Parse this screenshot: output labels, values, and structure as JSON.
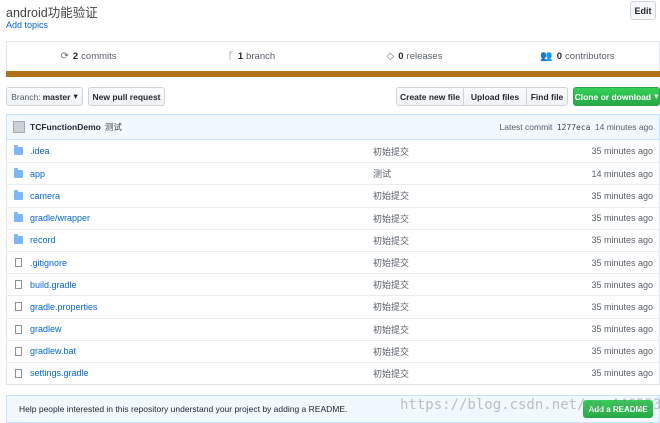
{
  "repo": {
    "title": "android功能验证",
    "add_topics": "Add topics",
    "edit_label": "Edit"
  },
  "summary": {
    "commits_count": "2",
    "commits_label": "commits",
    "branches_count": "1",
    "branches_label": "branch",
    "releases_count": "0",
    "releases_label": "releases",
    "contributors_count": "0",
    "contributors_label": "contributors"
  },
  "colors": {
    "language_bar": "#b07219",
    "primary_green": "#28a745",
    "link": "#0366d6"
  },
  "toolbar": {
    "branch_label": "Branch:",
    "branch_value": "master",
    "new_pull_request": "New pull request",
    "create_new_file": "Create new file",
    "upload_files": "Upload files",
    "find_file": "Find file",
    "clone_or_download": "Clone or download"
  },
  "latest_commit": {
    "author": "TCFunctionDemo",
    "message": "测试",
    "prefix": "Latest commit",
    "sha": "1277eca",
    "time": "14 minutes ago"
  },
  "files": [
    {
      "name": ".idea",
      "type": "dir",
      "message": "初始提交",
      "age": "35 minutes ago"
    },
    {
      "name": "app",
      "type": "dir",
      "message": "测试",
      "age": "14 minutes ago"
    },
    {
      "name": "camera",
      "type": "dir",
      "message": "初始提交",
      "age": "35 minutes ago"
    },
    {
      "name": "gradle/wrapper",
      "type": "dir",
      "message": "初始提交",
      "age": "35 minutes ago"
    },
    {
      "name": "record",
      "type": "dir",
      "message": "初始提交",
      "age": "35 minutes ago"
    },
    {
      "name": ".gitignore",
      "type": "file",
      "message": "初始提交",
      "age": "35 minutes ago"
    },
    {
      "name": "build.gradle",
      "type": "file",
      "message": "初始提交",
      "age": "35 minutes ago"
    },
    {
      "name": "gradle.properties",
      "type": "file",
      "message": "初始提交",
      "age": "35 minutes ago"
    },
    {
      "name": "gradlew",
      "type": "file",
      "message": "初始提交",
      "age": "35 minutes ago"
    },
    {
      "name": "gradlew.bat",
      "type": "file",
      "message": "初始提交",
      "age": "35 minutes ago"
    },
    {
      "name": "settings.gradle",
      "type": "file",
      "message": "初始提交",
      "age": "35 minutes ago"
    }
  ],
  "readme_prompt": {
    "text": "Help people interested in this repository understand your project by adding a README.",
    "button": "Add a README"
  },
  "watermark": "https://blog.csdn.net/qq_44655333"
}
